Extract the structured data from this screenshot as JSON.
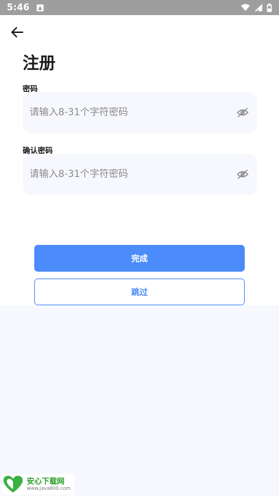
{
  "status_bar": {
    "time": "5:46",
    "icons": [
      "app-notification-icon",
      "wifi-icon",
      "signal-icon",
      "battery-icon"
    ]
  },
  "header": {
    "back_icon": "arrow-left-icon",
    "title": "注册"
  },
  "form": {
    "password": {
      "label": "密码",
      "placeholder": "请输入8-31个字符密码",
      "value": "",
      "toggle_icon": "eye-off-icon"
    },
    "confirm_password": {
      "label": "确认密码",
      "placeholder": "请输入8-31个字符密码",
      "value": "",
      "toggle_icon": "eye-off-icon"
    }
  },
  "actions": {
    "complete_label": "完成",
    "skip_label": "跳过"
  },
  "watermark": {
    "name": "安心下载网",
    "url": "www.java800.com"
  },
  "colors": {
    "accent": "#4b8bfa",
    "field_bg": "#f7f8fd",
    "status_bar": "#9e9e9e"
  }
}
